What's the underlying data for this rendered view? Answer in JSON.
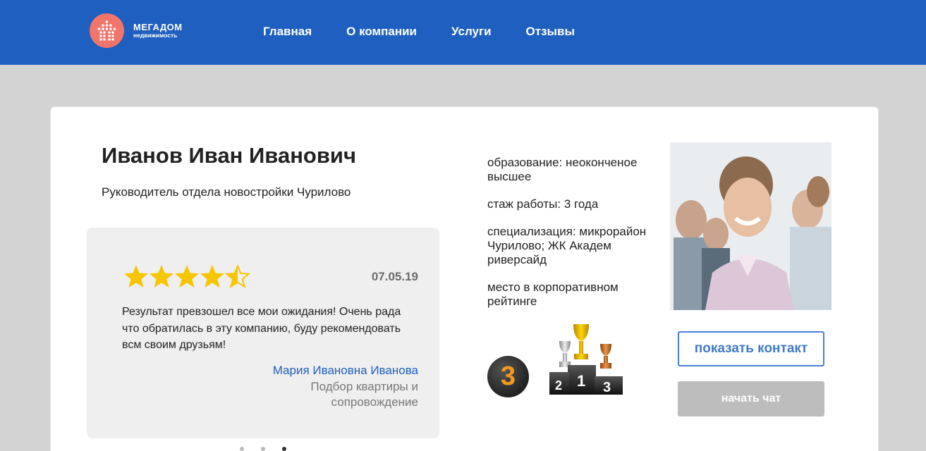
{
  "header": {
    "logo": {
      "brand": "МЕГАДОМ",
      "tagline": "недвижимость"
    },
    "nav": [
      "Главная",
      "О компании",
      "Услуги",
      "Отзывы"
    ],
    "bg_color": "#1f5fbf"
  },
  "profile": {
    "last_name": "Иванов",
    "first_middle": "Иван Иванович",
    "position": "Руководитель отдела новостройки Чурилово",
    "info": [
      "образование: неоконченое высшее",
      "стаж работы: 3 года",
      "специализация: микрорайон Чурилово; ЖК Академ риверсайд",
      "место в корпоративном рейтинге"
    ],
    "rank": "3",
    "podium_labels": [
      "2",
      "1",
      "3"
    ],
    "buttons": {
      "contact": "показать контакт",
      "chat": "начать чат"
    }
  },
  "review": {
    "rating": 4.5,
    "max_rating": 5,
    "date": "07.05.19",
    "text": "Результат превзошел все мои ожидания! Очень рада что обратилась в эту компанию, буду рекомендовать всм своим друзьям!",
    "author": "Мария Ивановна Иванова",
    "service": "Подбор квартиры и сопровождение"
  },
  "carousel": {
    "count": 3,
    "active": 3
  },
  "colors": {
    "accent": "#1f5fbf",
    "star": "#f7c600",
    "rank": "#f39a1e",
    "logo": "#f2746b"
  }
}
